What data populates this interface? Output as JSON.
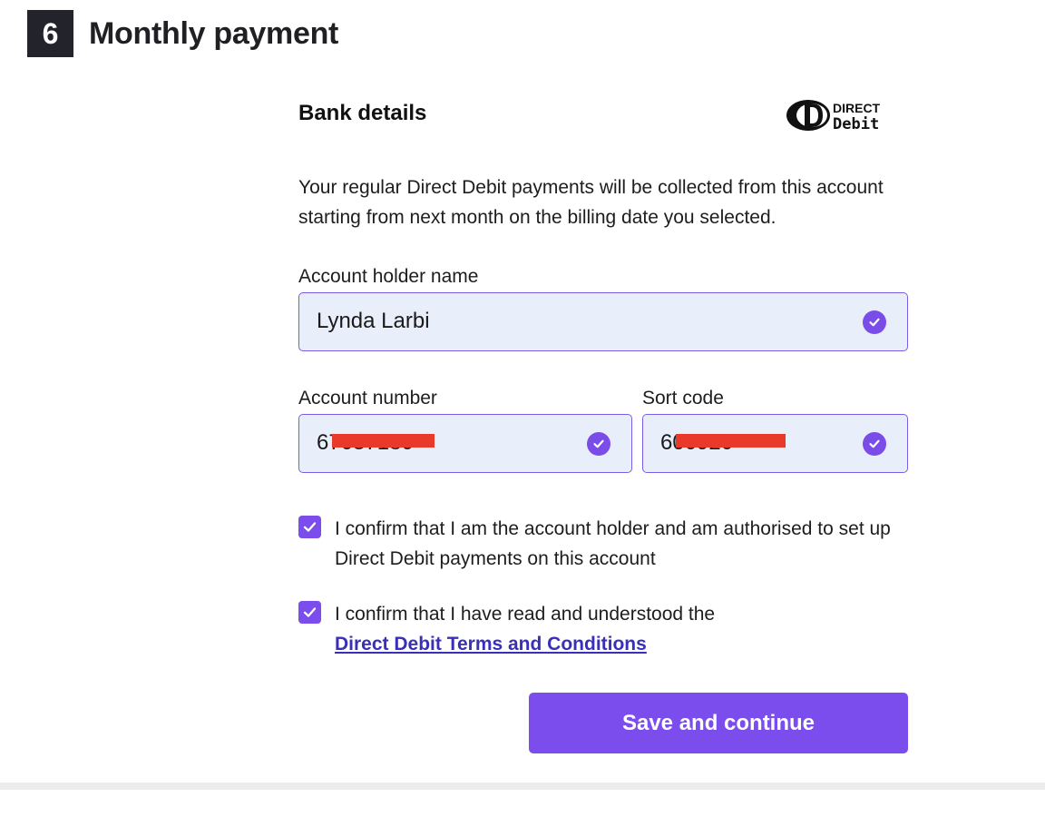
{
  "step": {
    "number": "6",
    "title": "Monthly payment"
  },
  "bank": {
    "title": "Bank details",
    "logo_line1": "DIRECT",
    "logo_line2": "Debit",
    "intro": "Your regular Direct Debit payments will be collected from this account starting from next month on the billing date you selected."
  },
  "fields": {
    "holder_label": "Account holder name",
    "holder_value": "Lynda Larbi",
    "account_label": "Account number",
    "account_value": "67037180",
    "sort_label": "Sort code",
    "sort_value": "600920"
  },
  "confirm": {
    "holder_text": "I confirm that I am the account holder and am authorised to set up Direct Debit payments on this account",
    "holder_checked": true,
    "terms_text": "I confirm that I have read and understood the",
    "terms_link": "Direct Debit Terms and Conditions",
    "terms_checked": true
  },
  "actions": {
    "save_label": "Save and continue"
  },
  "colors": {
    "accent": "#7b4ded",
    "field_bg": "#e9eefb",
    "link": "#3a2fb8",
    "redaction": "#e8392a"
  },
  "icons": {
    "field_valid": "check-circle-icon",
    "checkbox": "check-icon"
  }
}
